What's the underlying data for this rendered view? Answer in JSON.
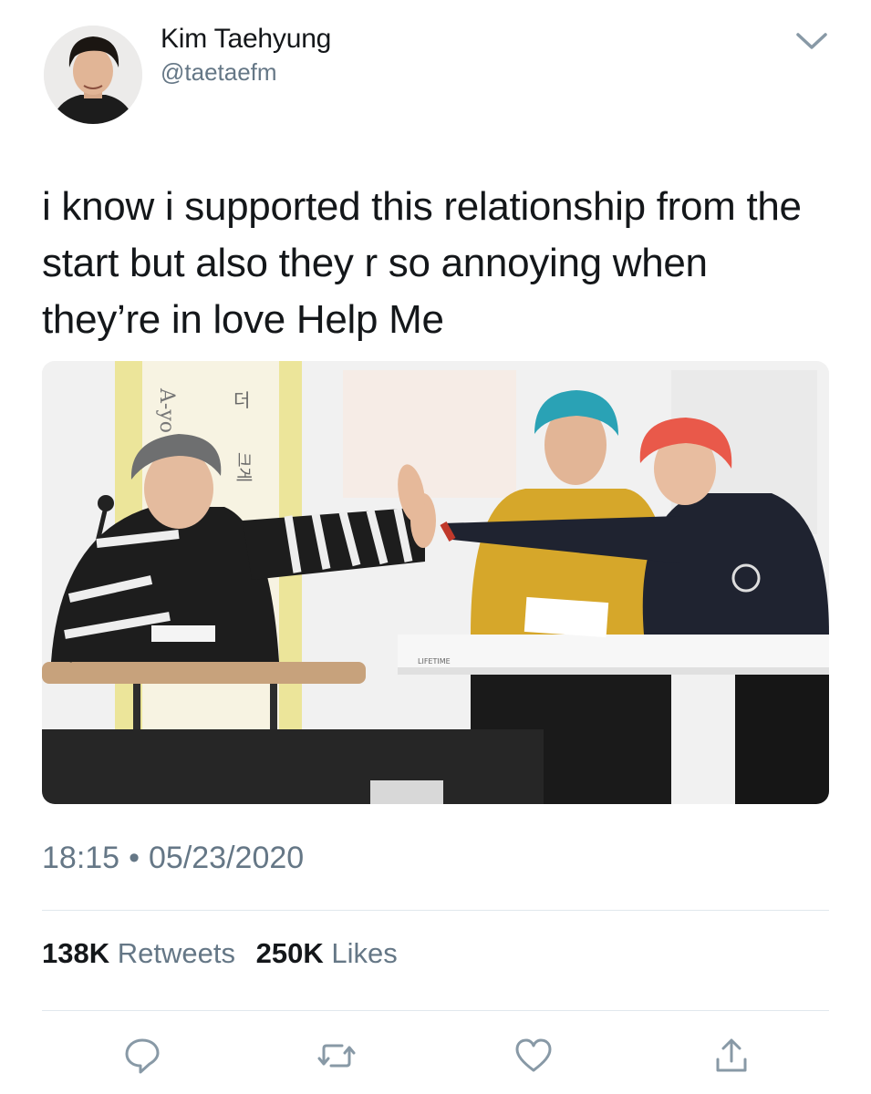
{
  "author": {
    "display_name": "Kim Taehyung",
    "handle": "@taetaefm"
  },
  "tweet": {
    "text": "i know i supported this relationship from the start but also they r so annoying when they’re in love Help Me",
    "time": "18:15",
    "separator": "•",
    "date": "05/23/2020"
  },
  "media": {
    "poster_text_1": "A-yo",
    "poster_text_2": "더",
    "poster_text_3": "크게",
    "table_label": "LIFETIME"
  },
  "stats": {
    "retweets_count": "138K",
    "retweets_label": "Retweets",
    "likes_count": "250K",
    "likes_label": "Likes"
  },
  "icons": {
    "menu": "chevron-down-icon",
    "reply": "reply-icon",
    "retweet": "retweet-icon",
    "like": "heart-icon",
    "share": "share-icon"
  },
  "colors": {
    "primary_text": "#14171a",
    "secondary_text": "#657786",
    "divider": "#e1e8ed"
  }
}
